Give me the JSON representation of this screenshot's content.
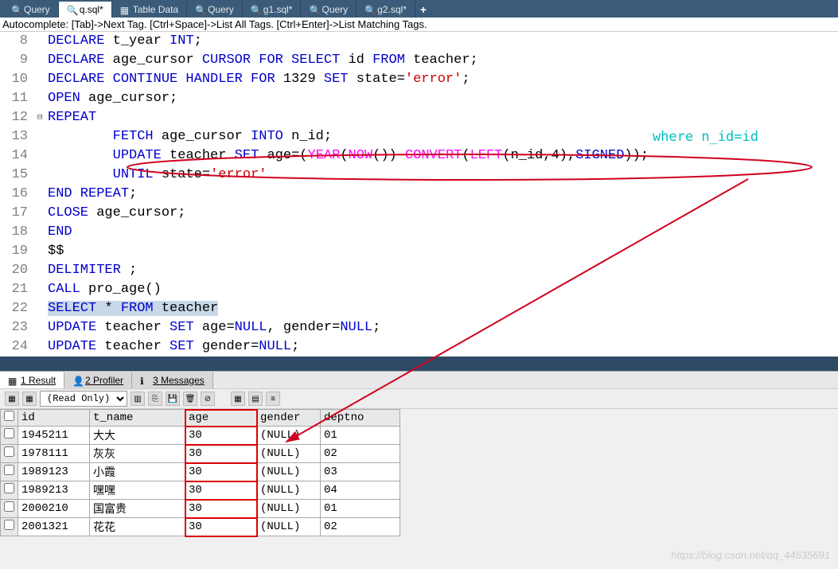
{
  "tabs": [
    {
      "label": "Query",
      "icon": "query-icon",
      "active": false
    },
    {
      "label": "q.sql*",
      "icon": "sql-icon",
      "active": true
    },
    {
      "label": "Table Data",
      "icon": "table-icon",
      "active": false
    },
    {
      "label": "Query",
      "icon": "query-icon",
      "active": false
    },
    {
      "label": "g1.sql*",
      "icon": "sql-icon",
      "active": false
    },
    {
      "label": "Query",
      "icon": "query-icon",
      "active": false
    },
    {
      "label": "g2.sql*",
      "icon": "sql-icon",
      "active": false
    }
  ],
  "add_tab": "+",
  "hint": "Autocomplete: [Tab]->Next Tag. [Ctrl+Space]->List All Tags. [Ctrl+Enter]->List Matching Tags.",
  "annotation": "where n_id=id",
  "code": {
    "l8": "DECLARE t_year INT;",
    "l9": "DECLARE age_cursor CURSOR FOR SELECT id FROM teacher;",
    "l10": "DECLARE CONTINUE HANDLER FOR 1329 SET state='error';",
    "l11": "OPEN age_cursor;",
    "l12": "REPEAT",
    "l13": "        FETCH age_cursor INTO n_id;",
    "l14": "        UPDATE teacher SET age=(YEAR(NOW())-CONVERT(LEFT(n_id,4),SIGNED));",
    "l15": "        UNTIL state='error'",
    "l16": "END REPEAT;",
    "l17": "CLOSE age_cursor;",
    "l18": "END",
    "l19": "$$",
    "l20": "DELIMITER ;",
    "l21": "CALL pro_age()",
    "l22": "SELECT * FROM teacher",
    "l23": "UPDATE teacher SET age=NULL, gender=NULL;",
    "l24": "UPDATE teacher SET gender=NULL;"
  },
  "line_nums": [
    "8",
    "9",
    "10",
    "11",
    "12",
    "13",
    "14",
    "15",
    "16",
    "17",
    "18",
    "19",
    "20",
    "21",
    "22",
    "23",
    "24"
  ],
  "result_tabs": {
    "r1": "1 Result",
    "r2": "2 Profiler",
    "r3": "3 Messages"
  },
  "toolbar": {
    "readonly": "(Read Only)"
  },
  "grid": {
    "headers": [
      "id",
      "t_name",
      "age",
      "gender",
      "deptno"
    ],
    "rows": [
      {
        "id": "1945211",
        "t_name": "大大",
        "age": "30",
        "gender": "(NULL)",
        "deptno": "01"
      },
      {
        "id": "1978111",
        "t_name": "灰灰",
        "age": "30",
        "gender": "(NULL)",
        "deptno": "02"
      },
      {
        "id": "1989123",
        "t_name": "小霞",
        "age": "30",
        "gender": "(NULL)",
        "deptno": "03"
      },
      {
        "id": "1989213",
        "t_name": "嘿嘿",
        "age": "30",
        "gender": "(NULL)",
        "deptno": "04"
      },
      {
        "id": "2000210",
        "t_name": "国富贵",
        "age": "30",
        "gender": "(NULL)",
        "deptno": "01"
      },
      {
        "id": "2001321",
        "t_name": "花花",
        "age": "30",
        "gender": "(NULL)",
        "deptno": "02"
      }
    ]
  },
  "watermark": "https://blog.csdn.net/qq_44635691"
}
